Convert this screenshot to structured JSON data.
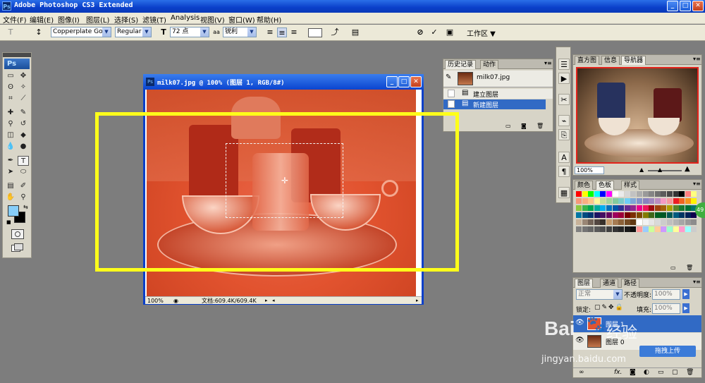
{
  "app": {
    "title": "Adobe Photoshop CS3 Extended",
    "win_min": "_",
    "win_max": "□",
    "win_close": "✕"
  },
  "menu": [
    "文件(F)",
    "编辑(E)",
    "图像(I)",
    "图层(L)",
    "选择(S)",
    "滤镜(T)",
    "Analysis",
    "视图(V)",
    "窗口(W)",
    "帮助(H)"
  ],
  "options": {
    "font_family": "Copperplate Go...",
    "font_style": "Regular",
    "font_size": "72 点",
    "antialias_icon": "aa",
    "antialias": "锐利",
    "workspace": "工作区 ▼"
  },
  "toolbox": {
    "logo": "Ps"
  },
  "document": {
    "title": "milk07.jpg @ 100% (图层 1, RGB/8#)",
    "zoom": "100%",
    "doc_info": "文档:609.4K/609.4K"
  },
  "history_panel": {
    "tabs": [
      "历史记录",
      "动作"
    ],
    "snapshot_name": "milk07.jpg",
    "items": [
      "建立图层",
      "新建图层"
    ]
  },
  "navigator_panel": {
    "tabs": [
      "直方图",
      "信息",
      "导航器"
    ],
    "zoom": "100%"
  },
  "color_panel": {
    "tabs": [
      "颜色",
      "色板",
      "样式"
    ]
  },
  "layers_panel": {
    "tabs": [
      "图层",
      "通道",
      "路径"
    ],
    "blend_mode": "正常",
    "opacity_label": "不透明度:",
    "opacity_value": "100%",
    "lock_label": "锁定:",
    "fill_label": "填充:",
    "fill_value": "100%",
    "layer1_name": "图层 1",
    "layer2_name": "图层 0",
    "upload_label": "拖拽上传"
  },
  "badge": "49",
  "watermark": {
    "brand": "Bai",
    "brand2": "经验",
    "url": "jingyan.baidu.com"
  },
  "colors": {
    "foreground": "#87cefa",
    "background": "#000000",
    "highlight": "#ffff1a",
    "canvas_tint": "#e2532f"
  }
}
